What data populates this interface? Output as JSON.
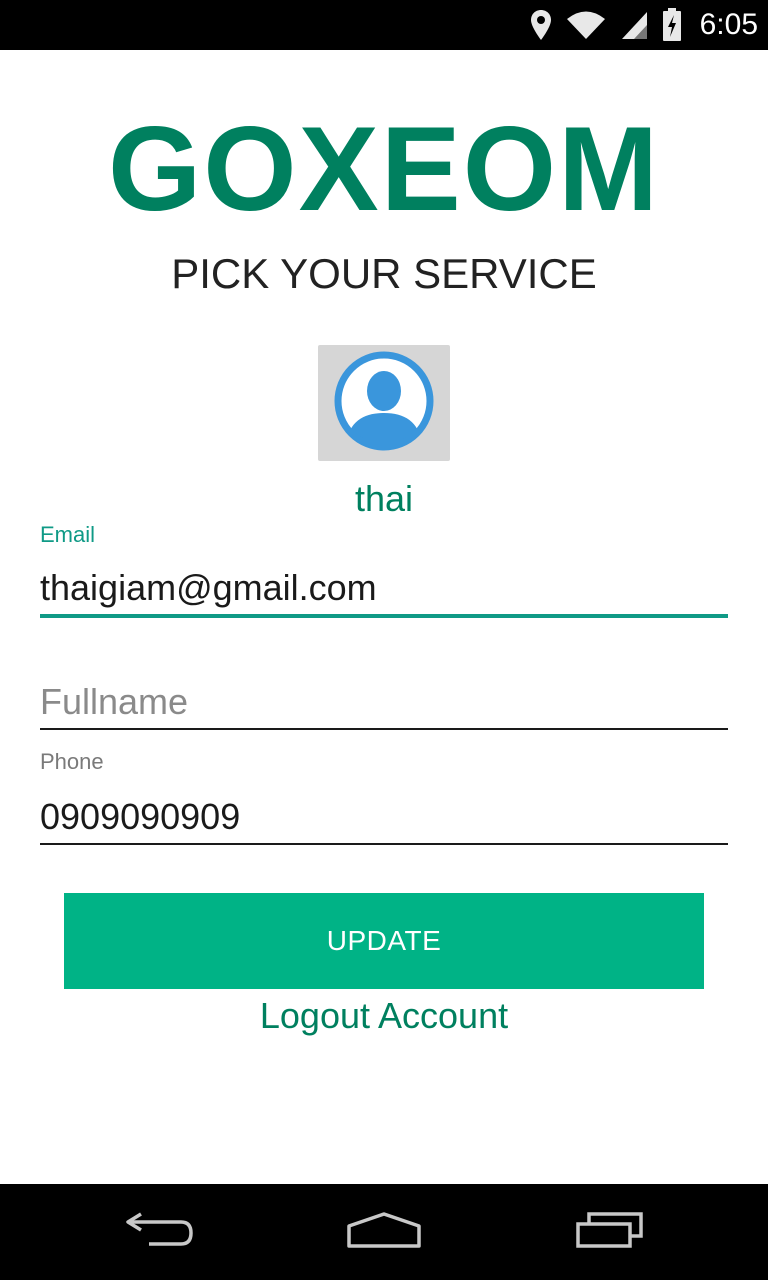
{
  "status_bar": {
    "time": "6:05",
    "icons": [
      "location-icon",
      "wifi-icon",
      "signal-icon",
      "battery-charging-icon"
    ]
  },
  "brand": {
    "title": "GOXEOM",
    "subtitle": "PICK YOUR SERVICE"
  },
  "profile": {
    "avatar_icon": "person-icon",
    "username": "thai"
  },
  "form": {
    "email": {
      "label": "Email",
      "value": "thaigiam@gmail.com"
    },
    "fullname": {
      "placeholder": "Fullname",
      "value": ""
    },
    "phone": {
      "label": "Phone",
      "value": "0909090909"
    }
  },
  "actions": {
    "update_label": "UPDATE",
    "logout_label": "Logout Account"
  },
  "nav_bar": {
    "icons": [
      "back-icon",
      "home-icon",
      "recents-icon"
    ]
  },
  "colors": {
    "brand": "#00805f",
    "accent": "#0f9a86",
    "button": "#00b386",
    "avatar_bg": "#d6d6d6",
    "avatar_icon": "#3a96dc"
  }
}
